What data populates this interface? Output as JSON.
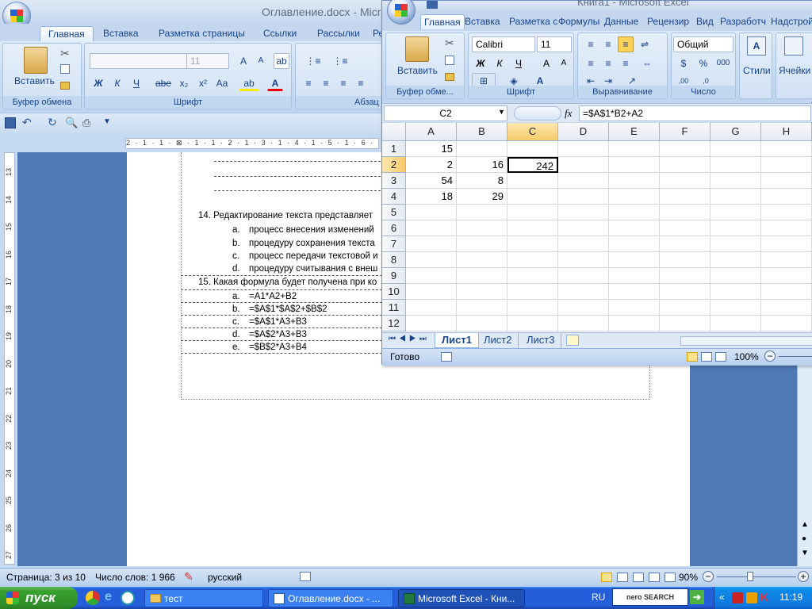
{
  "word": {
    "title": "Оглавление.docx - Micro",
    "tabs": [
      "Главная",
      "Вставка",
      "Разметка страницы",
      "Ссылки",
      "Рассылки",
      "Ре"
    ],
    "groups": {
      "clipboard": "Буфер обмена",
      "font": "Шрифт",
      "paragraph": "Абзац"
    },
    "paste_label": "Вставить",
    "font_size": "11",
    "font_buttons": [
      "Ж",
      "К",
      "Ч",
      "abe",
      "x₂",
      "x²",
      "Aa"
    ],
    "ruler_text": "2 · 1 · 1 · ⊠ · 1 · 1 · 2 · 1 · 3 · 1 · 4 · 1 · 5 · 1 · 6 · 1 · 7 ·",
    "vruler_numbers": [
      "13",
      "14",
      "15",
      "16",
      "17",
      "18",
      "19",
      "20",
      "21",
      "22",
      "23",
      "24",
      "25",
      "26",
      "27"
    ],
    "content": {
      "q14": "14. Редактирование текста представляет",
      "q14_options": [
        {
          "letter": "a.",
          "text": "процесс внесения изменений"
        },
        {
          "letter": "b.",
          "text": "процедуру сохранения текста"
        },
        {
          "letter": "c.",
          "text": "процесс передачи текстовой и"
        },
        {
          "letter": "d.",
          "text": "процедуру считывания с внеш"
        }
      ],
      "q15": "15. Какая формула будет получена при ко",
      "q15_options": [
        {
          "letter": "a.",
          "text": "=A1*A2+B2"
        },
        {
          "letter": "b.",
          "text": "=$A$1*$A$2+$B$2"
        },
        {
          "letter": "c.",
          "text": "=$A$1*A3+B3"
        },
        {
          "letter": "d.",
          "text": "=$A$2*A3+B3"
        },
        {
          "letter": "e.",
          "text": "=$B$2*A3+B4"
        }
      ]
    },
    "status": {
      "page": "Страница: 3 из 10",
      "words": "Число слов: 1 966",
      "lang": "русский",
      "zoom": "90%"
    }
  },
  "excel": {
    "title": "Книга1 - Microsoft Excel",
    "tabs": [
      "Главная",
      "Вставка",
      "Разметка с",
      "Формулы",
      "Данные",
      "Рецензир",
      "Вид",
      "Разработч",
      "Надстрой"
    ],
    "groups": {
      "clipboard": "Буфер обме...",
      "font": "Шрифт",
      "alignment": "Выравнивание",
      "number": "Число"
    },
    "paste_label": "Вставить",
    "font_name": "Calibri",
    "font_size": "11",
    "font_buttons": [
      "Ж",
      "К",
      "Ч"
    ],
    "number_format": "Общий",
    "styles_label": "Стили",
    "cells_label": "Ячейки",
    "name_box": "C2",
    "fx": "fx",
    "formula": "=$A$1*B2+A2",
    "columns": [
      "A",
      "B",
      "C",
      "D",
      "E",
      "F",
      "G",
      "H"
    ],
    "rows": [
      "1",
      "2",
      "3",
      "4",
      "5",
      "6",
      "7",
      "8",
      "9",
      "10",
      "11",
      "12"
    ],
    "cells": {
      "A1": "15",
      "A2": "2",
      "B2": "16",
      "C2": "242",
      "A3": "54",
      "B3": "8",
      "A4": "18",
      "B4": "29"
    },
    "sheets": [
      "Лист1",
      "Лист2",
      "Лист3"
    ],
    "active_sheet": "Лист1",
    "status": {
      "ready": "Готово",
      "zoom": "100%"
    }
  },
  "taskbar": {
    "start": "пуск",
    "buttons": [
      {
        "label": "тест",
        "active": false
      },
      {
        "label": "Оглавление.docx - ...",
        "active": false
      },
      {
        "label": "Microsoft Excel - Кни...",
        "active": true
      }
    ],
    "lang": "RU",
    "search": "nero SEARCH",
    "clock": "11:19"
  }
}
